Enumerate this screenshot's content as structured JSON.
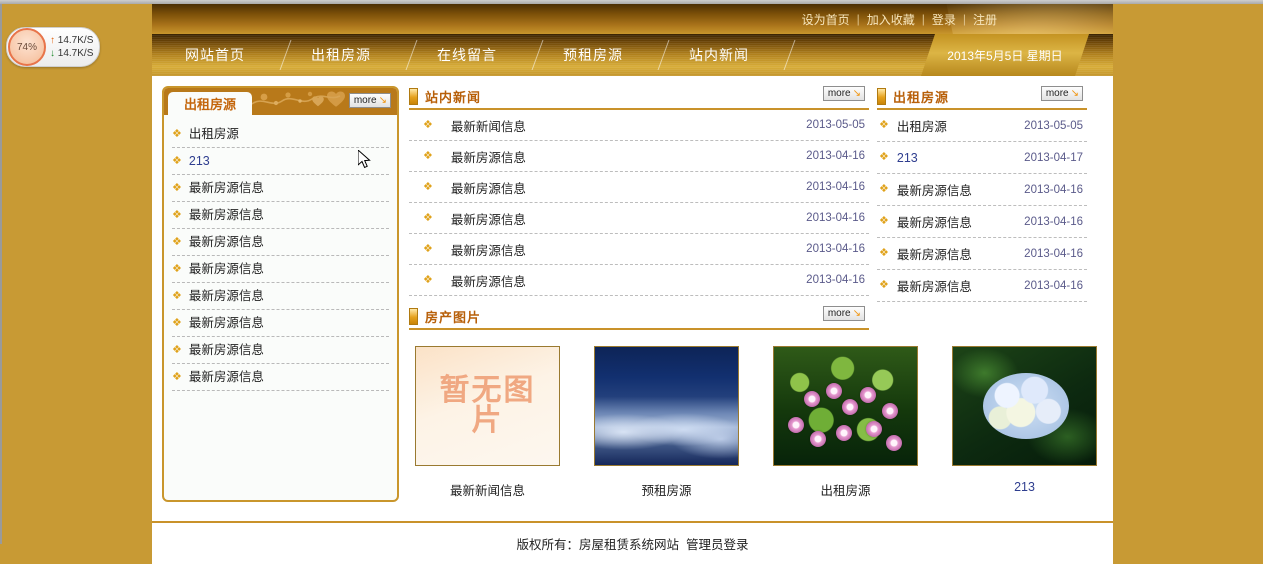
{
  "desktop_widget": {
    "name": "network-speed-meter",
    "cpu_percent": "74%",
    "upload": "14.7K/S",
    "download": "14.7K/S",
    "up_arrow": "↑",
    "down_arrow": "↓"
  },
  "header": {
    "top_links": [
      {
        "label": "设为首页"
      },
      {
        "label": "加入收藏"
      },
      {
        "label": "登录"
      },
      {
        "label": "注册"
      }
    ],
    "separator": "|",
    "date_label": "2013年5月5日 星期日"
  },
  "nav": {
    "items": [
      {
        "label": "网站首页"
      },
      {
        "label": "出租房源"
      },
      {
        "label": "在线留言"
      },
      {
        "label": "预租房源"
      },
      {
        "label": "站内新闻"
      }
    ]
  },
  "more_button": {
    "label": "more",
    "arrow": "↘"
  },
  "bullet_glyph": "❖",
  "left_panel": {
    "tab_label": "出租房源",
    "items": [
      {
        "label": "出租房源",
        "numeric": false
      },
      {
        "label": "213",
        "numeric": true
      },
      {
        "label": "最新房源信息",
        "numeric": false
      },
      {
        "label": "最新房源信息",
        "numeric": false
      },
      {
        "label": "最新房源信息",
        "numeric": false
      },
      {
        "label": "最新房源信息",
        "numeric": false
      },
      {
        "label": "最新房源信息",
        "numeric": false
      },
      {
        "label": "最新房源信息",
        "numeric": false
      },
      {
        "label": "最新房源信息",
        "numeric": false
      },
      {
        "label": "最新房源信息",
        "numeric": false
      }
    ]
  },
  "news_section": {
    "title": "站内新闻",
    "items": [
      {
        "title": "最新新闻信息",
        "date": "2013-05-05"
      },
      {
        "title": "最新房源信息",
        "date": "2013-04-16"
      },
      {
        "title": "最新房源信息",
        "date": "2013-04-16"
      },
      {
        "title": "最新房源信息",
        "date": "2013-04-16"
      },
      {
        "title": "最新房源信息",
        "date": "2013-04-16"
      },
      {
        "title": "最新房源信息",
        "date": "2013-04-16"
      }
    ]
  },
  "rent_section": {
    "title": "出租房源",
    "items": [
      {
        "title": "出租房源",
        "date": "2013-05-05",
        "numeric": false
      },
      {
        "title": "213",
        "date": "2013-04-17",
        "numeric": true
      },
      {
        "title": "最新房源信息",
        "date": "2013-04-16",
        "numeric": false
      },
      {
        "title": "最新房源信息",
        "date": "2013-04-16",
        "numeric": false
      },
      {
        "title": "最新房源信息",
        "date": "2013-04-16",
        "numeric": false
      },
      {
        "title": "最新房源信息",
        "date": "2013-04-16",
        "numeric": false
      }
    ]
  },
  "gallery": {
    "title": "房产图片",
    "items": [
      {
        "caption": "最新新闻信息",
        "image": "no-image-placeholder",
        "placeholder_text": "暂无图片",
        "numeric": false
      },
      {
        "caption": "预租房源",
        "image": "winter-forest-photo",
        "numeric": false
      },
      {
        "caption": "出租房源",
        "image": "lotus-pond-photo",
        "numeric": false
      },
      {
        "caption": "213",
        "image": "hydrangea-flower-photo",
        "numeric": true
      }
    ]
  },
  "footer": {
    "copyright": "版权所有：房屋租赁系统网站",
    "admin_link": "管理员登录"
  },
  "colors": {
    "page_background": "#c89a34",
    "nav_gold": "#d8ad39",
    "accent_brown": "#b8600a",
    "panel_border": "#c9962c",
    "link_blue": "#2f3e8f"
  }
}
